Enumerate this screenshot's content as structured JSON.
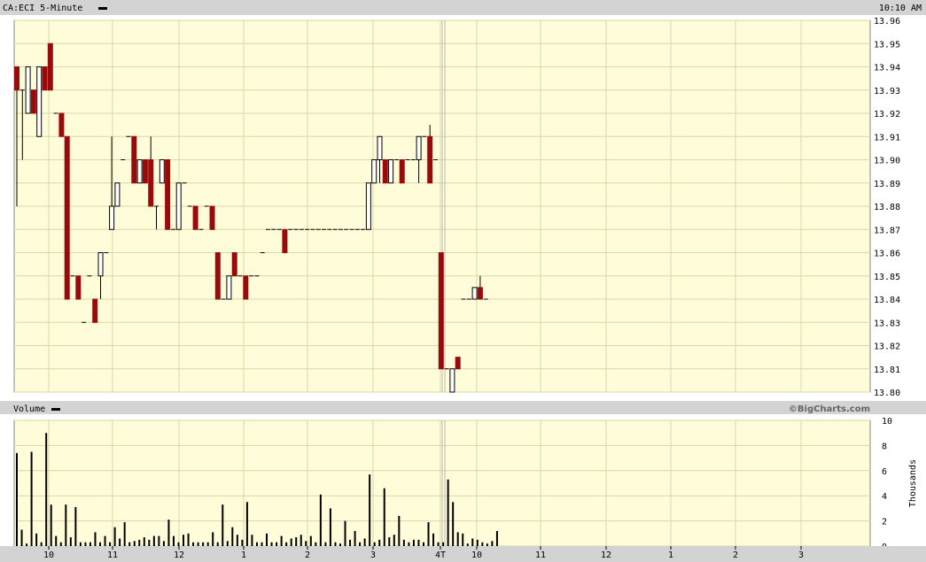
{
  "header": {
    "symbol_label": "CA:ECI 5-Minute",
    "time": "10:10 AM"
  },
  "volume_panel": {
    "label": "Volume",
    "copyright": "©BigCharts.com",
    "unit_label": "Thousands"
  },
  "colors": {
    "plot_bg": "#fffcd9",
    "grid": "#d8d8a8",
    "band": "#d3d3d3",
    "down_candle": "#9b0a0a",
    "up_candle": "#ffffff",
    "volume_bar": "#000000"
  },
  "chart_data": [
    {
      "type": "candlestick",
      "title": "CA:ECI 5-Minute",
      "x_tick_labels": [
        "10",
        "11",
        "12",
        "1",
        "2",
        "3",
        "4T",
        "10",
        "11",
        "12",
        "1",
        "2",
        "3"
      ],
      "ylim": [
        13.8,
        13.96
      ],
      "y_ticks": [
        "13.80",
        "13.81",
        "13.82",
        "13.83",
        "13.84",
        "13.85",
        "13.86",
        "13.87",
        "13.88",
        "13.89",
        "13.90",
        "13.91",
        "13.92",
        "13.93",
        "13.94",
        "13.95",
        "13.96"
      ],
      "grid": true,
      "candles": [
        [
          13.94,
          13.93,
          13.94,
          13.88
        ],
        [
          13.93,
          13.93,
          13.93,
          13.9
        ],
        [
          13.92,
          13.94,
          13.94,
          13.92
        ],
        [
          13.93,
          13.92,
          13.93,
          13.92
        ],
        [
          13.91,
          13.94,
          13.94,
          13.91
        ],
        [
          13.94,
          13.93,
          13.94,
          13.93
        ],
        [
          13.95,
          13.93,
          13.95,
          13.93
        ],
        [
          13.92,
          13.92,
          13.92,
          13.92
        ],
        [
          13.92,
          13.91,
          13.92,
          13.91
        ],
        [
          13.91,
          13.84,
          13.91,
          13.84
        ],
        [
          13.85,
          13.85,
          13.85,
          13.85
        ],
        [
          13.85,
          13.84,
          13.85,
          13.84
        ],
        [
          13.83,
          13.83,
          13.83,
          13.83
        ],
        [
          13.85,
          13.85,
          13.85,
          13.85
        ],
        [
          13.84,
          13.83,
          13.84,
          13.83
        ],
        [
          13.85,
          13.86,
          13.86,
          13.84
        ],
        [
          13.86,
          13.86,
          13.86,
          13.86
        ],
        [
          13.87,
          13.88,
          13.91,
          13.87
        ],
        [
          13.88,
          13.89,
          13.89,
          13.88
        ],
        [
          13.9,
          13.9,
          13.9,
          13.9
        ],
        [
          13.91,
          13.91,
          13.91,
          13.91
        ],
        [
          13.91,
          13.89,
          13.91,
          13.89
        ],
        [
          13.89,
          13.9,
          13.9,
          13.89
        ],
        [
          13.9,
          13.89,
          13.9,
          13.89
        ],
        [
          13.9,
          13.88,
          13.91,
          13.88
        ],
        [
          13.88,
          13.88,
          13.88,
          13.87
        ],
        [
          13.89,
          13.9,
          13.9,
          13.89
        ],
        [
          13.9,
          13.87,
          13.9,
          13.87
        ],
        [
          13.87,
          13.87,
          13.87,
          13.87
        ],
        [
          13.87,
          13.89,
          13.89,
          13.87
        ],
        [
          13.89,
          13.89,
          13.89,
          13.89
        ],
        [
          13.88,
          13.88,
          13.88,
          13.88
        ],
        [
          13.88,
          13.87,
          13.88,
          13.87
        ],
        [
          13.87,
          13.87,
          13.87,
          13.87
        ],
        [
          13.88,
          13.88,
          13.88,
          13.88
        ],
        [
          13.88,
          13.87,
          13.88,
          13.87
        ],
        [
          13.86,
          13.84,
          13.86,
          13.84
        ],
        [
          13.84,
          13.84,
          13.84,
          13.84
        ],
        [
          13.84,
          13.85,
          13.85,
          13.84
        ],
        [
          13.86,
          13.85,
          13.86,
          13.85
        ],
        [
          13.85,
          13.85,
          13.85,
          13.85
        ],
        [
          13.85,
          13.84,
          13.85,
          13.84
        ],
        [
          13.85,
          13.85,
          13.85,
          13.85
        ],
        [
          13.85,
          13.85,
          13.85,
          13.85
        ],
        [
          13.86,
          13.86,
          13.86,
          13.86
        ],
        [
          13.87,
          13.87,
          13.87,
          13.87
        ],
        [
          13.87,
          13.87,
          13.87,
          13.87
        ],
        [
          13.87,
          13.87,
          13.87,
          13.87
        ],
        [
          13.87,
          13.86,
          13.87,
          13.86
        ],
        [
          13.87,
          13.87,
          13.87,
          13.87
        ],
        [
          13.87,
          13.87,
          13.87,
          13.87
        ],
        [
          13.87,
          13.87,
          13.87,
          13.87
        ],
        [
          13.87,
          13.87,
          13.87,
          13.87
        ],
        [
          13.87,
          13.87,
          13.87,
          13.87
        ],
        [
          13.87,
          13.87,
          13.87,
          13.87
        ],
        [
          13.87,
          13.87,
          13.87,
          13.87
        ],
        [
          13.87,
          13.87,
          13.87,
          13.87
        ],
        [
          13.87,
          13.87,
          13.87,
          13.87
        ],
        [
          13.87,
          13.87,
          13.87,
          13.87
        ],
        [
          13.87,
          13.87,
          13.87,
          13.87
        ],
        [
          13.87,
          13.87,
          13.87,
          13.87
        ],
        [
          13.87,
          13.87,
          13.87,
          13.87
        ],
        [
          13.87,
          13.87,
          13.87,
          13.87
        ],
        [
          13.87,
          13.89,
          13.89,
          13.87
        ],
        [
          13.89,
          13.9,
          13.9,
          13.89
        ],
        [
          13.9,
          13.91,
          13.91,
          13.89
        ],
        [
          13.9,
          13.89,
          13.9,
          13.89
        ],
        [
          13.89,
          13.9,
          13.9,
          13.89
        ],
        [
          13.9,
          13.9,
          13.9,
          13.9
        ],
        [
          13.9,
          13.89,
          13.9,
          13.89
        ],
        [
          13.9,
          13.9,
          13.9,
          13.9
        ],
        [
          13.9,
          13.9,
          13.9,
          13.9
        ],
        [
          13.9,
          13.91,
          13.91,
          13.89
        ],
        [
          13.91,
          13.91,
          13.91,
          13.91
        ],
        [
          13.91,
          13.89,
          13.915,
          13.89
        ],
        [
          13.9,
          13.9,
          13.9,
          13.9
        ],
        [
          13.86,
          13.81,
          13.86,
          13.81
        ],
        [
          13.81,
          13.81,
          13.81,
          13.81
        ],
        [
          13.8,
          13.81,
          13.81,
          13.8
        ],
        [
          13.815,
          13.81,
          13.815,
          13.81
        ],
        [
          13.84,
          13.84,
          13.84,
          13.84
        ],
        [
          13.84,
          13.84,
          13.84,
          13.84
        ],
        [
          13.84,
          13.845,
          13.845,
          13.84
        ],
        [
          13.845,
          13.84,
          13.85,
          13.84
        ],
        [
          13.84,
          13.84,
          13.84,
          13.84
        ]
      ]
    },
    {
      "type": "bar",
      "title": "Volume",
      "ylabel": "Thousands",
      "ylim": [
        0,
        10
      ],
      "y_ticks": [
        "0",
        "2",
        "4",
        "6",
        "8",
        "10"
      ],
      "grid": true,
      "values": [
        7.4,
        1.3,
        0.2,
        7.5,
        1.0,
        0.3,
        9.0,
        3.3,
        0.8,
        0.3,
        3.3,
        0.7,
        3.1,
        0.3,
        0.3,
        0.3,
        1.1,
        0.3,
        0.8,
        0.3,
        1.5,
        0.6,
        1.9,
        0.3,
        0.4,
        0.5,
        0.7,
        0.5,
        0.8,
        0.8,
        0.4,
        2.1,
        0.8,
        0.3,
        0.9,
        1.0,
        0.3,
        0.3,
        0.3,
        0.3,
        1.1,
        0.3,
        3.3,
        0.4,
        1.5,
        0.9,
        0.5,
        3.5,
        0.9,
        0.3,
        0.3,
        1.0,
        0.3,
        0.3,
        0.8,
        0.3,
        0.6,
        0.7,
        0.9,
        0.4,
        0.8,
        0.3,
        4.1,
        0.3,
        3.0,
        0.3,
        0.2,
        2.0,
        0.5,
        1.2,
        0.3,
        0.6,
        5.7,
        0.3,
        0.5,
        4.6,
        0.7,
        0.9,
        2.4,
        0.5,
        0.3,
        0.5,
        0.5,
        0.3,
        1.9,
        1.0,
        0.3,
        0.3,
        5.3,
        3.5,
        1.1,
        1.0,
        0.2,
        0.6,
        0.5,
        0.3,
        0.2,
        0.4,
        1.2
      ]
    }
  ]
}
